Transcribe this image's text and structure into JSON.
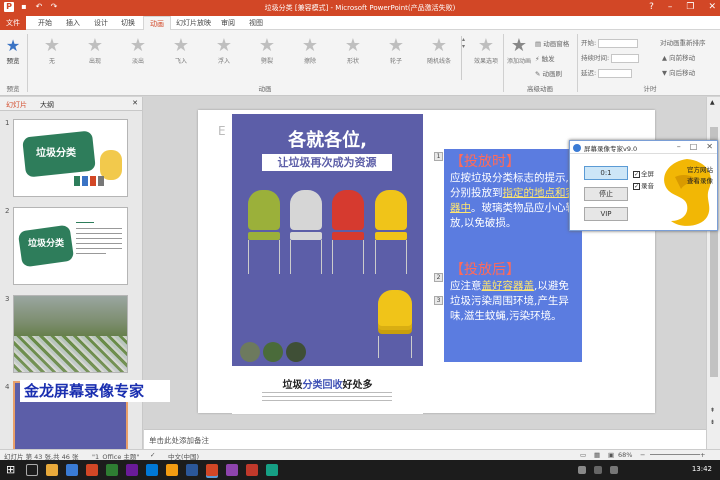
{
  "window": {
    "title": "垃圾分类 [兼容模式] - Microsoft PowerPoint(产品激活失败)"
  },
  "ribbon_tabs": [
    "开始",
    "插入",
    "设计",
    "切换",
    "动画",
    "幻灯片放映",
    "审阅",
    "视图"
  ],
  "file_tab": "文件",
  "active_tab": "动画",
  "ribbon": {
    "preview_label": "预览",
    "preview_group": "预览",
    "effects": [
      "无",
      "出现",
      "淡出",
      "飞入",
      "浮入",
      "劈裂",
      "擦除",
      "形状",
      "轮子",
      "随机线条"
    ],
    "animation_group": "动画",
    "effect_options": "效果选项",
    "add_animation": "添加动画",
    "animation_pane": "动画窗格",
    "trigger": "触发",
    "animation_painter": "动画刷",
    "advanced_group": "高级动画",
    "start_label": "开始:",
    "duration_label": "持续时间:",
    "delay_label": "延迟:",
    "reorder_label": "对动画重新排序",
    "move_earlier": "向前移动",
    "move_later": "向后移动",
    "timing_group": "计时"
  },
  "left_pane": {
    "tab_slides": "幻灯片",
    "tab_outline": "大纲",
    "thumbnails": [
      {
        "number": "1",
        "title": "垃圾分类"
      },
      {
        "number": "2",
        "title": "垃圾分类"
      },
      {
        "number": "3",
        "title": ""
      },
      {
        "number": "4",
        "title": ""
      }
    ]
  },
  "slide": {
    "poster_heading": "各就各位,",
    "poster_subhead": "让垃圾再次成为资源",
    "poster_bottom_prefix": "垃圾",
    "poster_bottom_highlight": "分类回收",
    "poster_bottom_suffix": "好处多",
    "textbox": {
      "heading1": "【投放时】",
      "para1_a": "应按垃圾分类标志的提示,分别投放到",
      "para1_ul": "指定的地点和容器中",
      "para1_b": "。玻璃类物品应小心轻放,以免破损。",
      "heading2": "【投放后】",
      "para2_a": "应注意",
      "para2_ul": "盖好容器盖",
      "para2_b": ",以避免垃圾污染周围环境,产生异味,滋生蚊蝇,污染环境。"
    },
    "anim_markers": [
      "1",
      "2",
      "3"
    ]
  },
  "notes_placeholder": "单击此处添加备注",
  "statusbar": {
    "slide_info": "幻灯片 第 43 张,共 46 张",
    "theme": "\"1_Office 主题\"",
    "language": "中文(中国)",
    "zoom": "68%"
  },
  "taskbar": {
    "time": "13:42"
  },
  "recorder": {
    "title": "屏幕录像专家v9.0",
    "timer": "0:1",
    "stop": "停止",
    "vip": "VIP",
    "fullscreen": "全屏",
    "audio": "录音",
    "official_site": "官方网站",
    "view_recording": "查看录像"
  },
  "watermark": "金龙屏幕录像专家",
  "colors": {
    "accent": "#d24726",
    "poster_bg": "#5c5ea8",
    "textbox_bg": "#5b7ce0",
    "textbox_heading": "#ff6a5a"
  }
}
